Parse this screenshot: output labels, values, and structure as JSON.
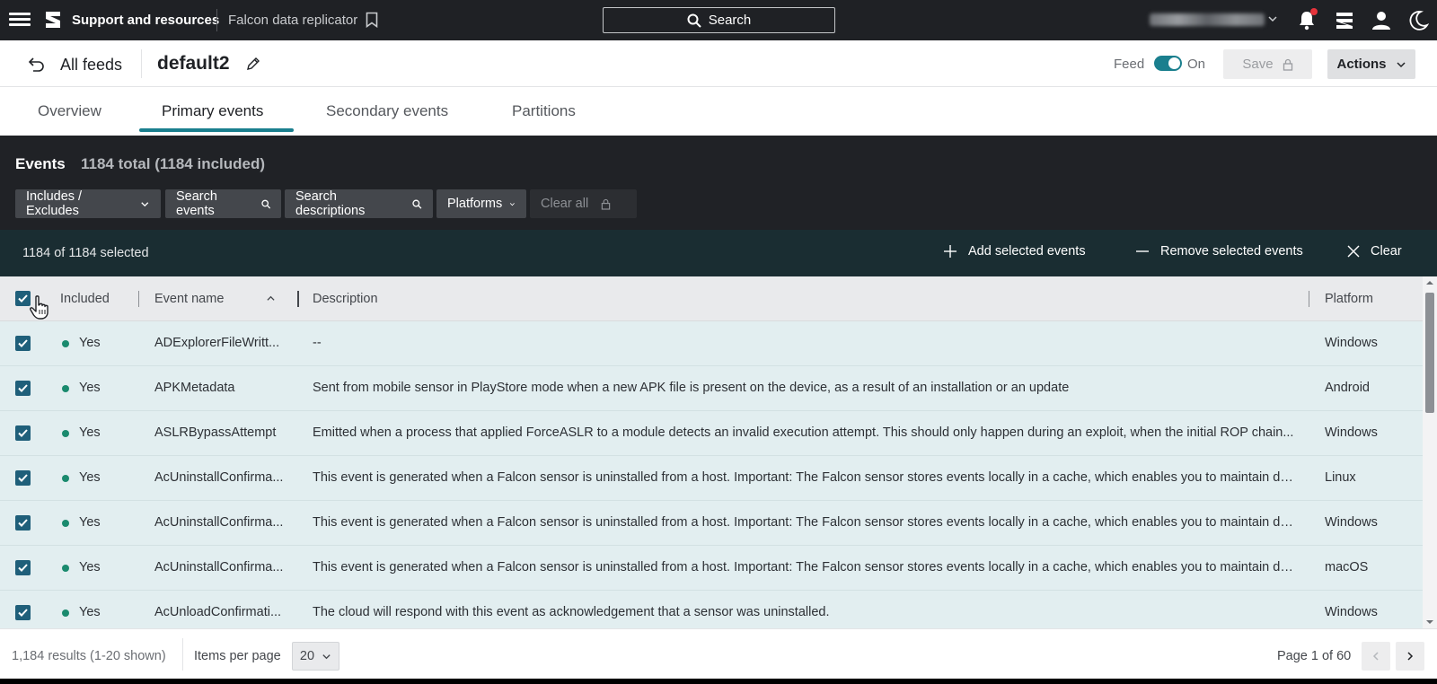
{
  "topbar": {
    "brand": "Support and resources",
    "product": "Falcon data replicator",
    "search_label": "Search"
  },
  "feed": {
    "back_label": "All feeds",
    "name": "default2",
    "feed_label": "Feed",
    "toggle_state": "On",
    "save_label": "Save",
    "actions_label": "Actions"
  },
  "tabs": [
    {
      "label": "Overview",
      "active": false
    },
    {
      "label": "Primary events",
      "active": true
    },
    {
      "label": "Secondary events",
      "active": false
    },
    {
      "label": "Partitions",
      "active": false
    }
  ],
  "events": {
    "title": "Events",
    "count": "1184 total (1184 included)",
    "filters": {
      "includes": "Includes / Excludes",
      "search_events": "Search events",
      "search_desc": "Search descriptions",
      "platforms": "Platforms",
      "clear_all": "Clear all"
    }
  },
  "selection": {
    "count": "1184 of 1184 selected",
    "add": "Add selected events",
    "remove": "Remove selected events",
    "clear": "Clear"
  },
  "table": {
    "headers": {
      "included": "Included",
      "event_name": "Event name",
      "description": "Description",
      "platform": "Platform"
    },
    "rows": [
      {
        "included": "Yes",
        "name": "ADExplorerFileWritt...",
        "desc": "--",
        "platform": "Windows"
      },
      {
        "included": "Yes",
        "name": "APKMetadata",
        "desc": "Sent from mobile sensor in PlayStore mode when a new APK file is present on the device, as a result of an installation or an update",
        "platform": "Android"
      },
      {
        "included": "Yes",
        "name": "ASLRBypassAttempt",
        "desc": "Emitted when a process that applied ForceASLR to a module detects an invalid execution attempt. This should only happen during an exploit, when the initial ROP chain...",
        "platform": "Windows"
      },
      {
        "included": "Yes",
        "name": "AcUninstallConfirma...",
        "desc": "This event is generated when a Falcon sensor is uninstalled from a host. Important: The Falcon sensor stores events locally in a cache, which enables you to maintain dat...",
        "platform": "Linux"
      },
      {
        "included": "Yes",
        "name": "AcUninstallConfirma...",
        "desc": "This event is generated when a Falcon sensor is uninstalled from a host. Important: The Falcon sensor stores events locally in a cache, which enables you to maintain dat...",
        "platform": "Windows"
      },
      {
        "included": "Yes",
        "name": "AcUninstallConfirma...",
        "desc": "This event is generated when a Falcon sensor is uninstalled from a host. Important: The Falcon sensor stores events locally in a cache, which enables you to maintain dat...",
        "platform": "macOS"
      },
      {
        "included": "Yes",
        "name": "AcUnloadConfirmati...",
        "desc": "The cloud will respond with this event as acknowledgement that a sensor was uninstalled.",
        "platform": "Windows"
      }
    ]
  },
  "footer": {
    "results": "1,184 results (1-20 shown)",
    "ipp_label": "Items per page",
    "ipp_value": "20",
    "page_info": "Page 1 of 60"
  },
  "colors": {
    "accent": "#1a7f8e",
    "topbar_bg": "#1f2125",
    "row_bg": "#e2eef0",
    "included_dot": "#1a8a6e",
    "notification": "#e5333b"
  }
}
